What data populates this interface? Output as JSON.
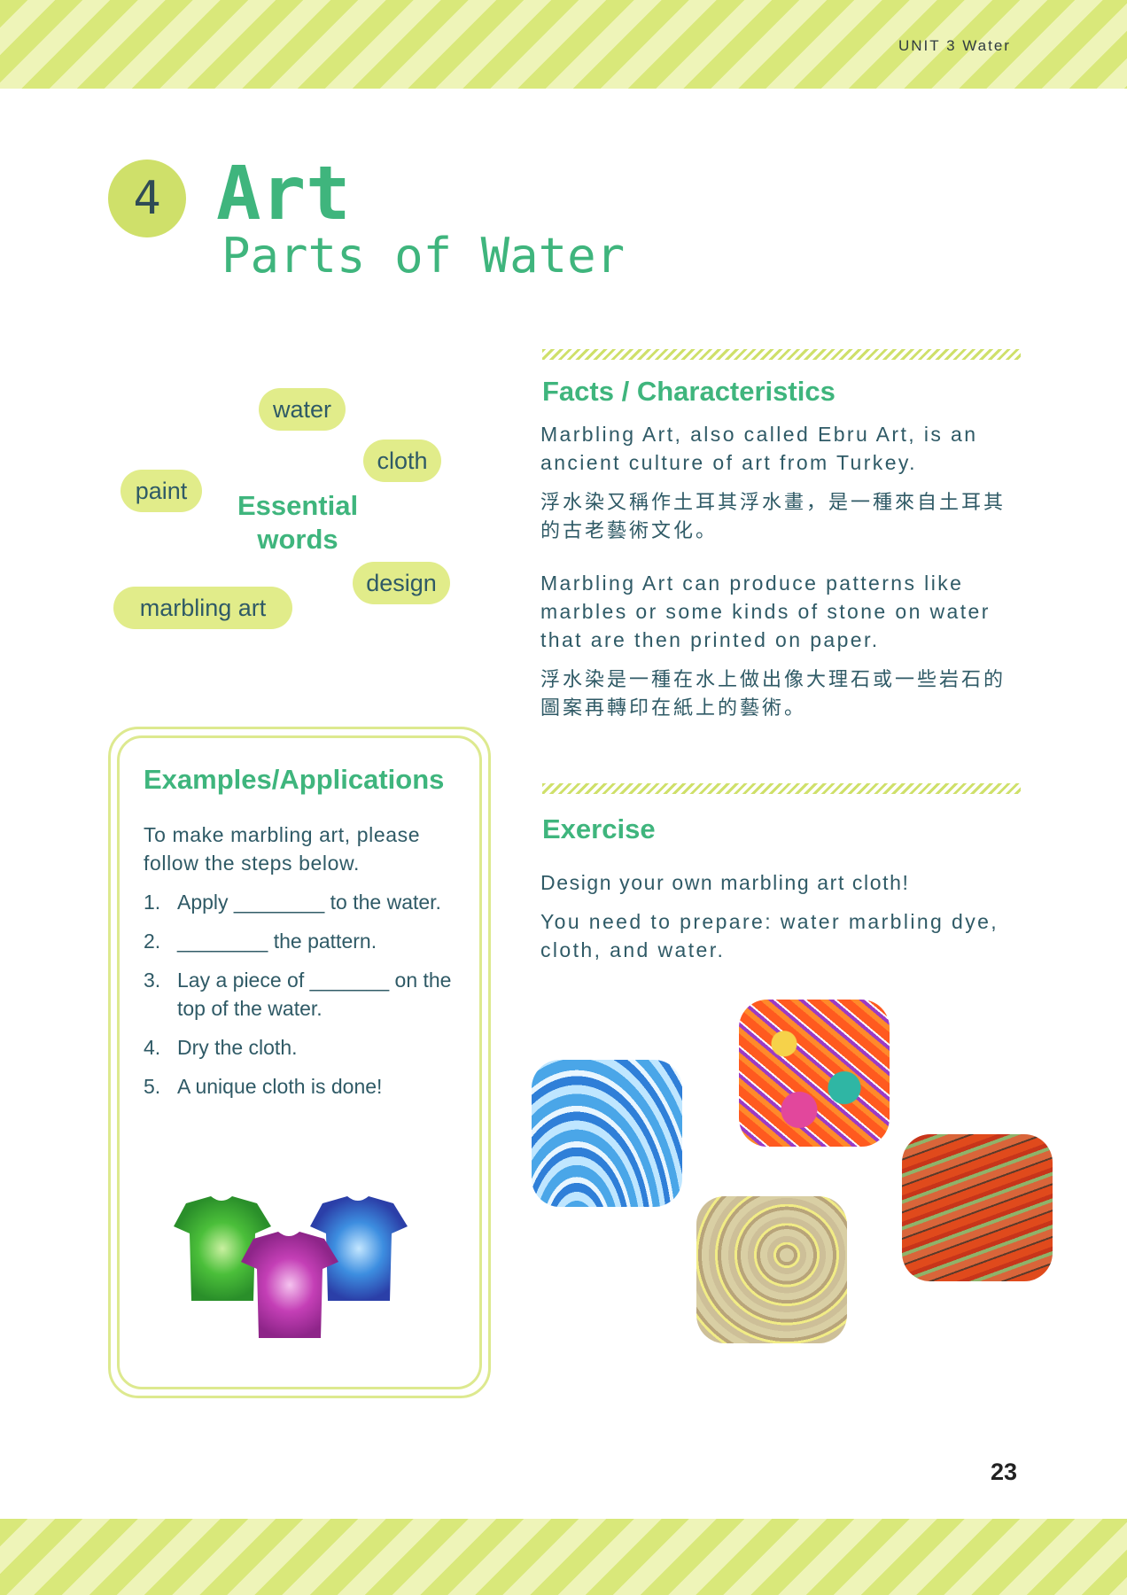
{
  "header": {
    "unit": "UNIT 3  Water"
  },
  "chapter": {
    "number": "4",
    "title": "Art",
    "subtitle": "Parts of Water"
  },
  "essential_words": {
    "heading_line1": "Essential",
    "heading_line2": "words",
    "chips": [
      "water",
      "cloth",
      "paint",
      "design",
      "marbling art"
    ]
  },
  "examples": {
    "title": "Examples/Applications",
    "intro": "To make marbling art, please follow the steps below.",
    "steps": [
      {
        "n": "1.",
        "text": "Apply ________ to the water."
      },
      {
        "n": "2.",
        "text": "________ the pattern."
      },
      {
        "n": "3.",
        "text": "Lay a piece of _______ on the top of the water."
      },
      {
        "n": "4.",
        "text": "Dry the cloth."
      },
      {
        "n": "5.",
        "text": "A unique cloth is done!"
      }
    ]
  },
  "facts": {
    "title": "Facts / Characteristics",
    "p1_en": "Marbling Art, also called Ebru Art, is an ancient culture of art from Turkey.",
    "p1_zh": "浮水染又稱作土耳其浮水畫，是一種來自土耳其的古老藝術文化。",
    "p2_en": "Marbling Art can produce patterns like marbles or some kinds of stone on water that are then printed on paper.",
    "p2_zh": "浮水染是一種在水上做出像大理石或一些岩石的圖案再轉印在紙上的藝術。"
  },
  "exercise": {
    "title": "Exercise",
    "line1": "Design your own marbling art cloth!",
    "line2": "You need to prepare: water marbling dye, cloth, and water."
  },
  "page_number": "23",
  "colors": {
    "accent_green": "#3fb57d",
    "chip_yellow": "#e1ec8a",
    "stripe": "#d9e87a",
    "text": "#2f5a66"
  }
}
